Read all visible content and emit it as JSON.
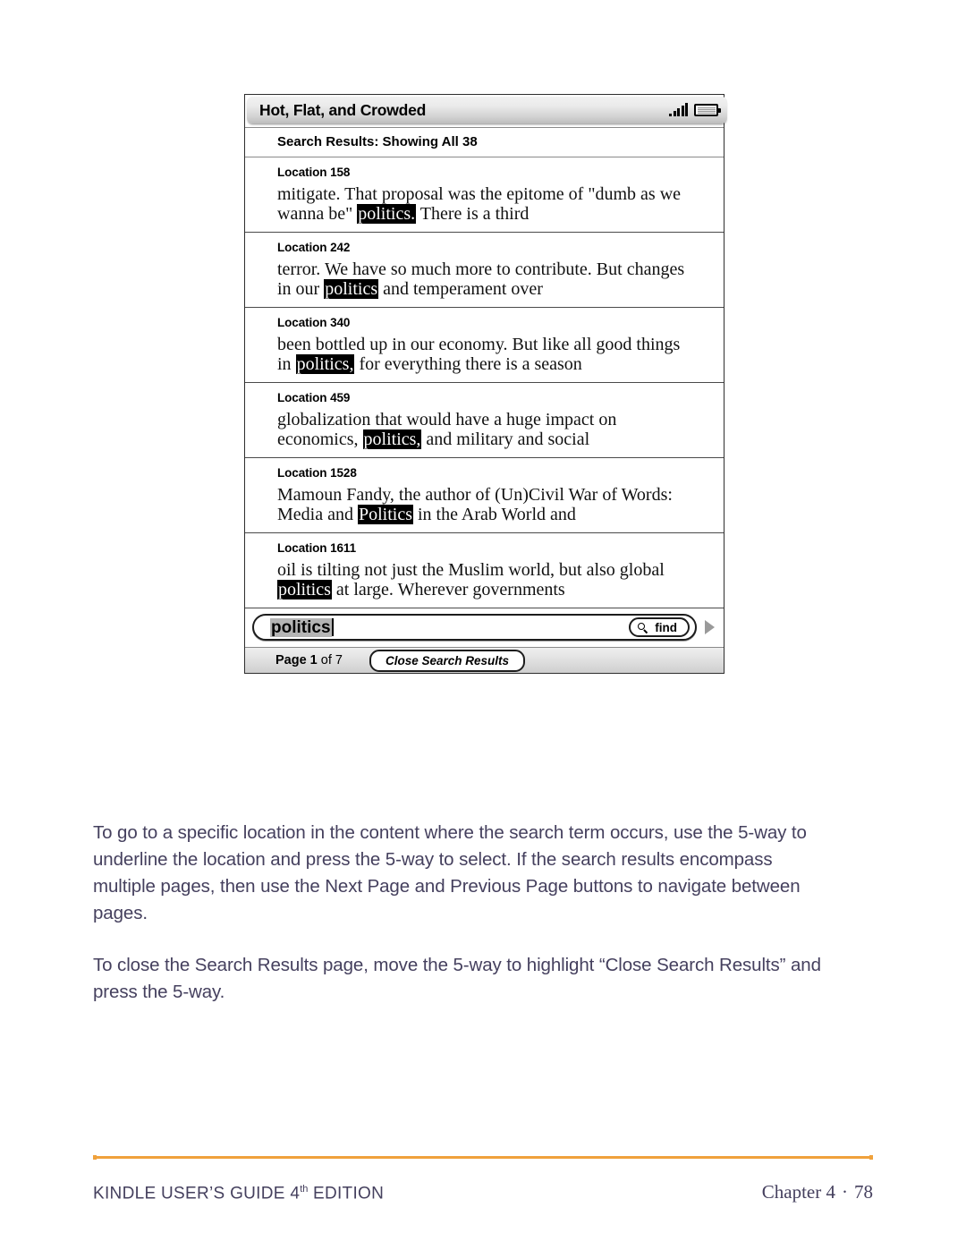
{
  "device": {
    "title": "Hot, Flat, and Crowded",
    "status_icons": {
      "signal": "signal-bars-icon",
      "battery": "battery-icon"
    },
    "results_header": "Search Results: Showing All 38",
    "results": [
      {
        "location_label": "Location 158",
        "before": "mitigate. That proposal was the epitome of \"dumb as we wanna be\" ",
        "highlight": "politics.",
        "after": " There is a third"
      },
      {
        "location_label": "Location 242",
        "before": "terror. We have so much more to contribute. But changes in our ",
        "highlight": "politics",
        "after": " and temperament over"
      },
      {
        "location_label": "Location 340",
        "before": "been bottled up in our economy. But like all good things in ",
        "highlight": "politics,",
        "after": " for everything there is a season"
      },
      {
        "location_label": "Location 459",
        "before": "globalization that would have a huge impact on economics, ",
        "highlight": "politics,",
        "after": " and military and social"
      },
      {
        "location_label": "Location 1528",
        "before": "Mamoun Fandy, the author of (Un)Civil War of Words: Media and ",
        "highlight": "Politics",
        "after": " in the Arab World and"
      },
      {
        "location_label": "Location 1611",
        "before": "oil is tilting not just the Muslim world, but also global ",
        "highlight": "politics",
        "after": " at large. Wherever governments"
      }
    ],
    "search": {
      "value": "politics",
      "find_label": "find",
      "find_icon": "magnifier-icon",
      "next_icon": "next-arrow-icon"
    },
    "statusbar": {
      "page_prefix": "Page 1",
      "page_suffix": " of 7",
      "close_label": "Close Search Results"
    }
  },
  "body": {
    "paragraphs": [
      "To go to a specific location in the content where the search term occurs, use the 5-way to underline the location and press the 5-way to select. If the search results encompass multiple pages, then use the Next Page and Previous Page buttons to navigate between pages.",
      "To close the Search Results page, move the 5-way to highlight “Close Search Results” and press the 5-way."
    ]
  },
  "footer": {
    "guide_prefix": "KINDLE USER’S GUIDE 4",
    "guide_sup": "th",
    "guide_suffix": " EDITION",
    "chapter": "Chapter 4",
    "separator": "·",
    "page_number": "78",
    "rule_color": "#f0a13c",
    "text_color": "#45405e"
  }
}
